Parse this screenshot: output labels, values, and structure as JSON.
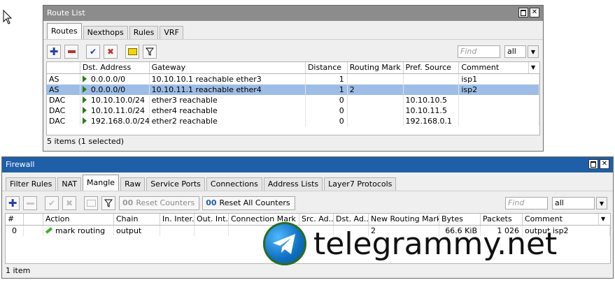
{
  "route_window": {
    "title": "Route List",
    "tabs": [
      "Routes",
      "Nexthops",
      "Rules",
      "VRF"
    ],
    "find_placeholder": "Find",
    "filter_value": "all",
    "columns": [
      "",
      "Dst. Address",
      "Gateway",
      "Distance",
      "Routing Mark",
      "Pref. Source",
      "Comment"
    ],
    "rows": [
      {
        "flags": "AS",
        "dst": "0.0.0.0/0",
        "gateway": "10.10.10.1 reachable ether3",
        "distance": "1",
        "mark": "",
        "pref": "",
        "comment": "isp1"
      },
      {
        "flags": "AS",
        "dst": "0.0.0.0/0",
        "gateway": "10.10.11.1 reachable ether4",
        "distance": "1",
        "mark": "2",
        "pref": "",
        "comment": "isp2"
      },
      {
        "flags": "DAC",
        "dst": "10.10.10.0/24",
        "gateway": "ether3 reachable",
        "distance": "0",
        "mark": "",
        "pref": "10.10.10.5",
        "comment": ""
      },
      {
        "flags": "DAC",
        "dst": "10.10.11.0/24",
        "gateway": "ether4 reachable",
        "distance": "0",
        "mark": "",
        "pref": "10.10.11.5",
        "comment": ""
      },
      {
        "flags": "DAC",
        "dst": "192.168.0.0/24",
        "gateway": "ether2 reachable",
        "distance": "0",
        "mark": "",
        "pref": "192.168.0.1",
        "comment": ""
      }
    ],
    "status": "5 items (1 selected)"
  },
  "firewall_window": {
    "title": "Firewall",
    "tabs": [
      "Filter Rules",
      "NAT",
      "Mangle",
      "Raw",
      "Service Ports",
      "Connections",
      "Address Lists",
      "Layer7 Protocols"
    ],
    "reset_counters": "Reset Counters",
    "reset_all_counters": "Reset All Counters",
    "find_placeholder": "Find",
    "filter_value": "all",
    "columns": [
      "#",
      "",
      "Action",
      "Chain",
      "In. Inter...",
      "Out. Int...",
      "Connection Mark",
      "Src. Ad...",
      "Dst. Ad...",
      "New Routing Mark",
      "Bytes",
      "Packets",
      "Comment"
    ],
    "rows": [
      {
        "num": "0",
        "action": "mark routing",
        "chain": "output",
        "in": "",
        "out": "",
        "conn": "",
        "src": "",
        "dst": "",
        "newmark": "2",
        "bytes": "66.6 KiB",
        "packets": "1 026",
        "comment": "output isp2"
      }
    ],
    "status": "1 item"
  },
  "watermark": "telegrammy.net",
  "colors": {
    "title_active": "#8c8c8c",
    "title_firewall": "#1f5fa8",
    "selected_row": "#9dbde6"
  }
}
